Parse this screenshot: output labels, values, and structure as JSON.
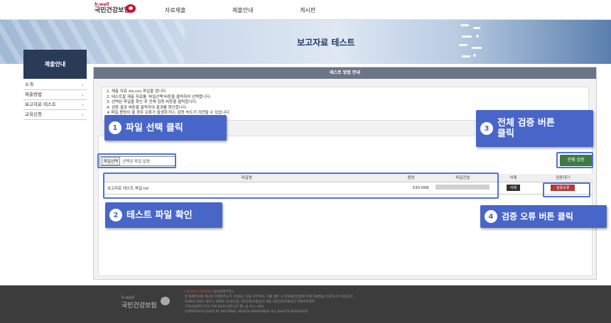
{
  "header": {
    "logo_small": "h-well",
    "logo_name": "국민건강보험",
    "nav": [
      "자료제출",
      "제출안내",
      "게시판"
    ]
  },
  "banner": {
    "title": "보고자료 테스트"
  },
  "sidebar": {
    "title": "제출안내",
    "items": [
      "소개",
      "제출방법",
      "보고자료 테스트",
      "교육신청"
    ]
  },
  "panel": {
    "heading": "테스트 방법 안내",
    "instructions": [
      "1. 제출 자료 xls,csv 파일을 엽니다.",
      "2. 테스트할 제출 자료를 '파일선택'버튼을 클릭하여 선택합니다.",
      "3. 선택된 파일을 확인 후 전체 검증 버튼을 클릭합니다.",
      "4. 검증 결과 버튼을 클릭하여 결과를 확인합니다.",
      "※ 파일 용량이 클 경우 오류가 발생하거나, 검증 속도가 지연될 수 있습니다."
    ],
    "file_button": "파일선택",
    "file_status": "선택된 파일 없음",
    "validate_all": "전체 검증",
    "table": {
      "headers": [
        "파일명",
        "용량",
        "파일전송",
        "삭제",
        "검증대기"
      ],
      "row": {
        "name": "보고자료 테스트 파일.txt",
        "size": "530.0KB",
        "delete": "삭제",
        "result": "검증오류"
      }
    }
  },
  "callouts": [
    {
      "num": "1",
      "label": "파일 선택 클릭"
    },
    {
      "num": "2",
      "label": "테스트 파일 확인"
    },
    {
      "num": "3",
      "label_line1": "전체 검증 버튼",
      "label_line2": "클릭"
    },
    {
      "num": "4",
      "label": "검증 오류 버튼 클릭"
    }
  ],
  "footer": {
    "logo_small": "h-well",
    "logo_name": "국민건강보험",
    "line1": "[개인정보 처리방침]",
    "line1b": "[윤리경영부문]",
    "line2": "본 홈페이지에 게시된 이메일주소가 수집되는 것을 거부하며, 이를 위반 시 정보통신망법에 의해 처벌됨을 유념하시기 바랍니다.",
    "line3": "26464 강원도 원주시 세계로 32(반곡동 국민건강보험공단) 9층 국민건강보험공단 빅데이터센터",
    "line4": "고객상담센터 033-736-2039 업무시간 월~금 9시~18시",
    "line5": "COPYRIGHT©2022 BY NATIONAL HEALTH INSURANCE ALL RIGHTS RESERVED"
  },
  "colors": {
    "accent": "#4866c8",
    "validate": "#3f7a45",
    "error": "#b03a3a",
    "sidebar": "#2a3b58"
  }
}
